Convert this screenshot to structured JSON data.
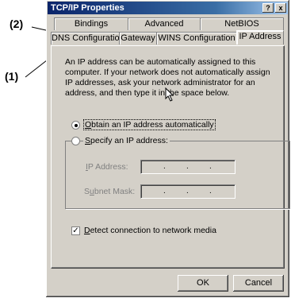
{
  "callouts": {
    "one": "(1)",
    "two": "(2)"
  },
  "window": {
    "title": "TCP/IP Properties",
    "help_glyph": "?",
    "close_glyph": "x"
  },
  "tabs": {
    "row_back": [
      "Bindings",
      "Advanced",
      "NetBIOS"
    ],
    "row_front": [
      "DNS Configuration",
      "Gateway",
      "WINS Configuration",
      "IP Address"
    ],
    "active": "IP Address"
  },
  "description": "An IP address can be automatically assigned to this computer. If your network does not automatically assign IP addresses, ask your network administrator for an address, and then type it in the space below.",
  "options": {
    "obtain_label_underlined": "O",
    "obtain_label_rest": "btain an IP address automatically",
    "specify_label_underlined": "S",
    "specify_label_rest": "pecify an IP address:",
    "selected": "obtain"
  },
  "fields": {
    "ip_label_underlined": "I",
    "ip_label_rest": "P Address:",
    "subnet_label_pre": "S",
    "subnet_label_underlined": "u",
    "subnet_label_rest": "bnet Mask:",
    "dot": "."
  },
  "detect": {
    "label_underlined": "D",
    "label_rest": "etect connection to network media",
    "checked": true,
    "check_glyph": "✓"
  },
  "buttons": {
    "ok": "OK",
    "cancel": "Cancel"
  },
  "colors": {
    "titlebar": "#0a246a",
    "face": "#d4d0c8"
  }
}
